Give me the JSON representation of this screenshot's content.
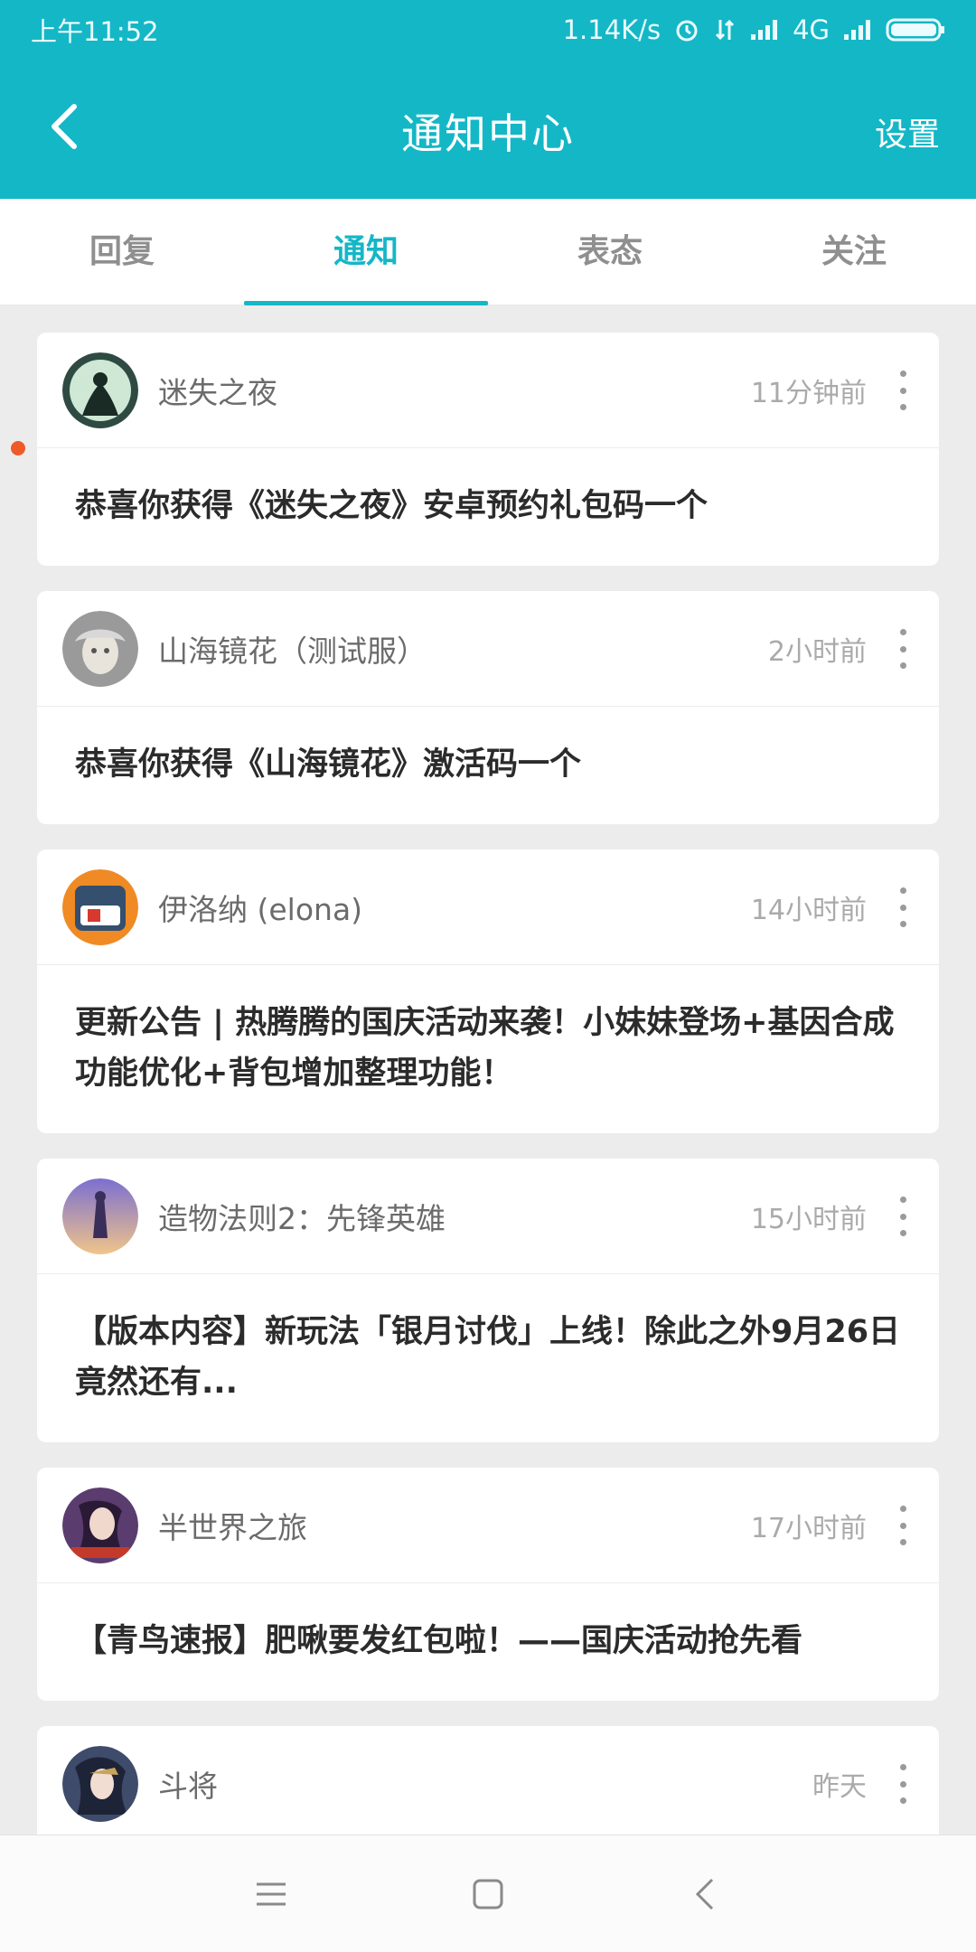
{
  "status_bar": {
    "time": "上午11:52",
    "network_speed": "1.14K/s",
    "network_type": "4G",
    "icons": [
      "alarm-icon",
      "data-transfer-icon",
      "signal-icon",
      "signal-icon",
      "battery-icon"
    ]
  },
  "header": {
    "title": "通知中心",
    "settings_label": "设置",
    "back_icon": "chevron-left-icon"
  },
  "tabs": [
    {
      "label": "回复"
    },
    {
      "label": "通知"
    },
    {
      "label": "表态"
    },
    {
      "label": "关注"
    }
  ],
  "notifications": [
    {
      "app": "迷失之夜",
      "time": "11分钟前",
      "message": "恭喜你获得《迷失之夜》安卓预约礼包码一个"
    },
    {
      "app": "山海镜花（测试服）",
      "time": "2小时前",
      "message": "恭喜你获得《山海镜花》激活码一个"
    },
    {
      "app": "伊洛纳 (elona)",
      "time": "14小时前",
      "message": "更新公告 | 热腾腾的国庆活动来袭！小妹妹登场+基因合成功能优化+背包增加整理功能！"
    },
    {
      "app": "造物法则2：先锋英雄",
      "time": "15小时前",
      "message": "【版本内容】新玩法「银月讨伐」上线！除此之外9月26日竟然还有..."
    },
    {
      "app": "半世界之旅",
      "time": "17小时前",
      "message": "【青鸟速报】肥啾要发红包啦！——国庆活动抢先看"
    },
    {
      "app": "斗将",
      "time": "昨天",
      "message": ""
    }
  ],
  "colors": {
    "accent": "#14b7c6",
    "unread": "#f05a28"
  }
}
